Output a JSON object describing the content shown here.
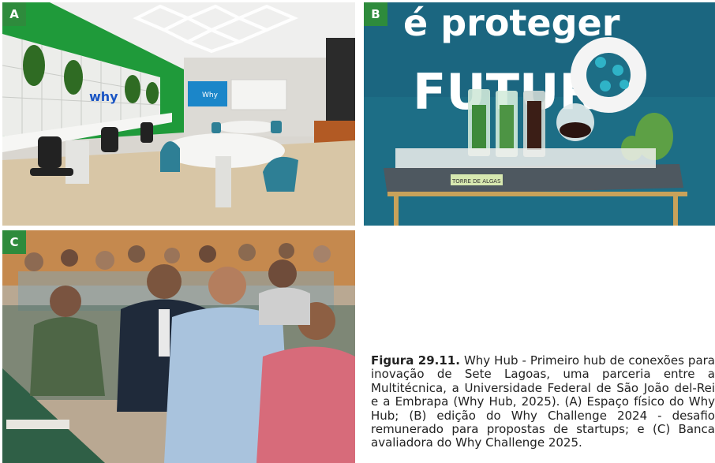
{
  "panels": [
    {
      "label": "A",
      "logo_text": "why",
      "screen_text": "Why"
    },
    {
      "label": "B",
      "banner_top": "é proteger",
      "banner_main": "FUTUR",
      "sign": "TORRE DE ALGAS"
    },
    {
      "label": "C"
    }
  ],
  "caption": {
    "figure": "Figura 29.11.",
    "text": " Why Hub - Primeiro hub de conexões para inovação de Sete Lagoas, uma parceria entre a Multitécnica, a Universidade Federal de São João del-Rei e a Embrapa (Why Hub, 2025). (A) Espaço físico do Why Hub; (B) edição do Why Challenge 2024 - desafio remunerado para propostas de startups; e (C) Banca avaliadora do Why Challenge 2025."
  },
  "colors": {
    "badge": "#2e8b3c",
    "banner": "#1d6e86",
    "green_wall": "#1f9a3a"
  }
}
